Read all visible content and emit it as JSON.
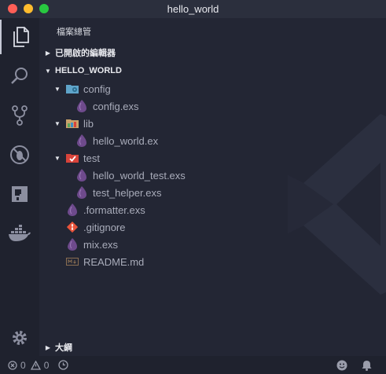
{
  "window": {
    "title": "hello_world"
  },
  "explorer": {
    "title": "檔案總管"
  },
  "sections": {
    "open_editors": "已開啟的編輯器",
    "project": "HELLO_WORLD",
    "outline": "大綱"
  },
  "tree": [
    {
      "label": "config",
      "kind": "folder",
      "icon": "folder-config-icon"
    },
    {
      "label": "config.exs",
      "kind": "file",
      "icon": "elixir-icon"
    },
    {
      "label": "lib",
      "kind": "folder",
      "icon": "folder-lib-icon"
    },
    {
      "label": "hello_world.ex",
      "kind": "file",
      "icon": "elixir-icon"
    },
    {
      "label": "test",
      "kind": "folder",
      "icon": "folder-test-icon"
    },
    {
      "label": "hello_world_test.exs",
      "kind": "file",
      "icon": "elixir-icon"
    },
    {
      "label": "test_helper.exs",
      "kind": "file",
      "icon": "elixir-icon"
    },
    {
      "label": ".formatter.exs",
      "kind": "file",
      "icon": "elixir-icon"
    },
    {
      "label": ".gitignore",
      "kind": "file",
      "icon": "git-icon"
    },
    {
      "label": "mix.exs",
      "kind": "file",
      "icon": "elixir-icon"
    },
    {
      "label": "README.md",
      "kind": "file",
      "icon": "markdown-icon"
    }
  ],
  "status": {
    "errors": "0",
    "warnings": "0"
  },
  "colors": {
    "elixir": "#6e4a8c",
    "git": "#e8533a",
    "folder_test": "#d8433a",
    "folder_config": "#5fa4c9"
  }
}
